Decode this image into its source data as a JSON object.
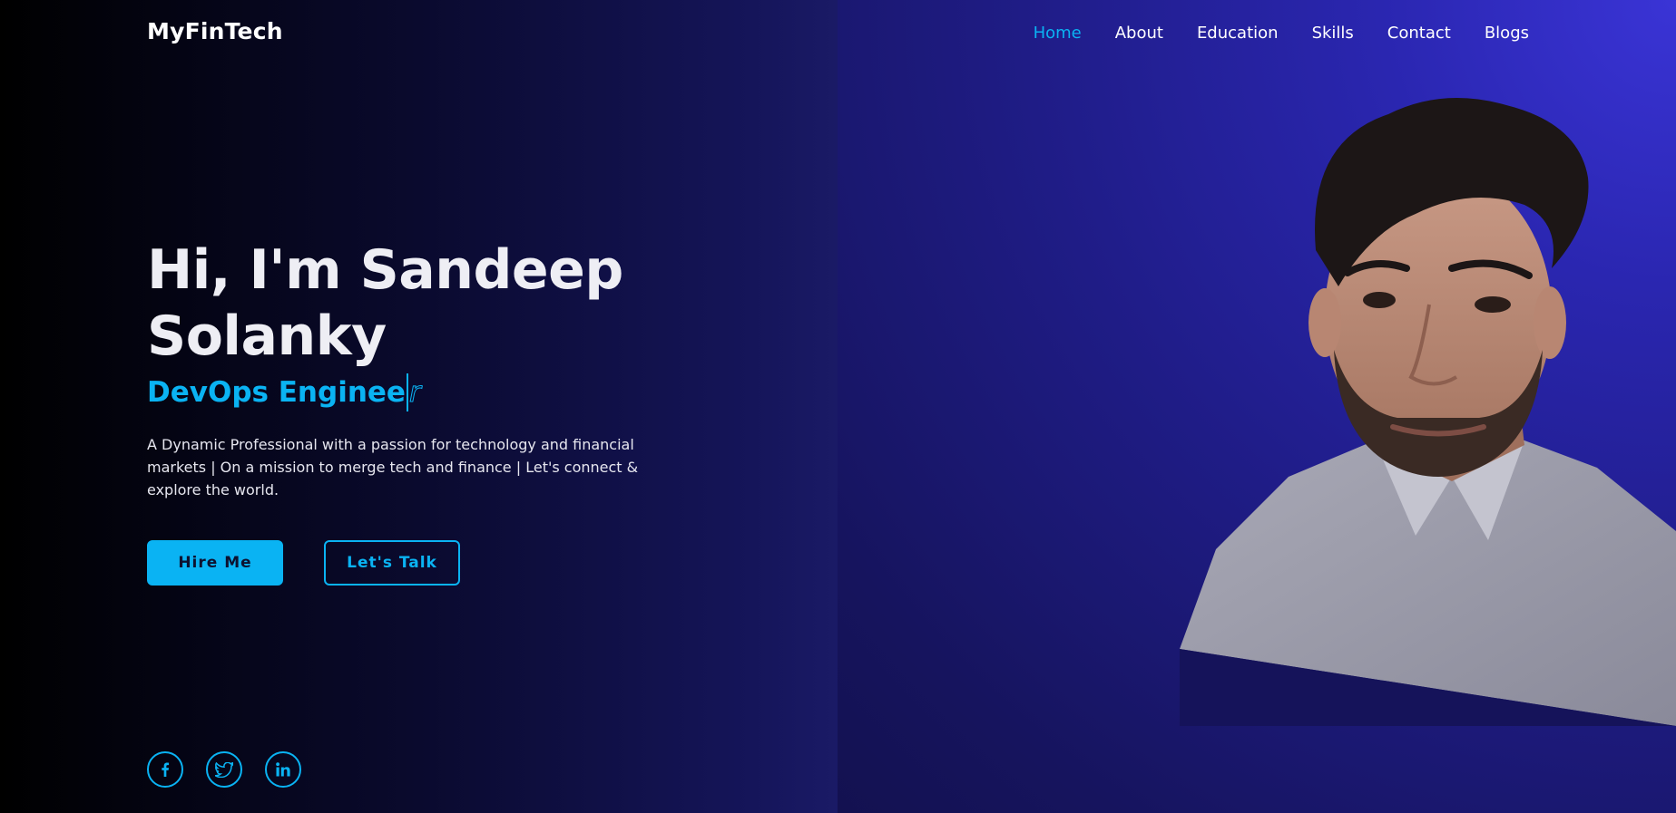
{
  "brand": {
    "name": "MyFinTech"
  },
  "nav": {
    "items": [
      {
        "label": "Home",
        "active": true
      },
      {
        "label": "About"
      },
      {
        "label": "Education"
      },
      {
        "label": "Skills"
      },
      {
        "label": "Contact"
      },
      {
        "label": "Blogs"
      }
    ]
  },
  "hero": {
    "greeting_line1": "Hi, I'm Sandeep",
    "greeting_line2": "Solanky",
    "role_typed": "DevOps Engine",
    "role_next_char": "e",
    "role_ghost": "r",
    "description": "A Dynamic Professional with a passion for technology and financial markets | On a mission to merge tech and finance | Let's connect & explore the world.",
    "hire_label": "Hire Me",
    "talk_label": "Let's Talk"
  },
  "social": {
    "icons": [
      "facebook-icon",
      "twitter-icon",
      "linkedin-icon"
    ]
  },
  "colors": {
    "accent": "#0ab3f3",
    "background_dark": "#000000",
    "background_indigo": "#1b1b6e",
    "background_violet": "#3a34d6"
  }
}
